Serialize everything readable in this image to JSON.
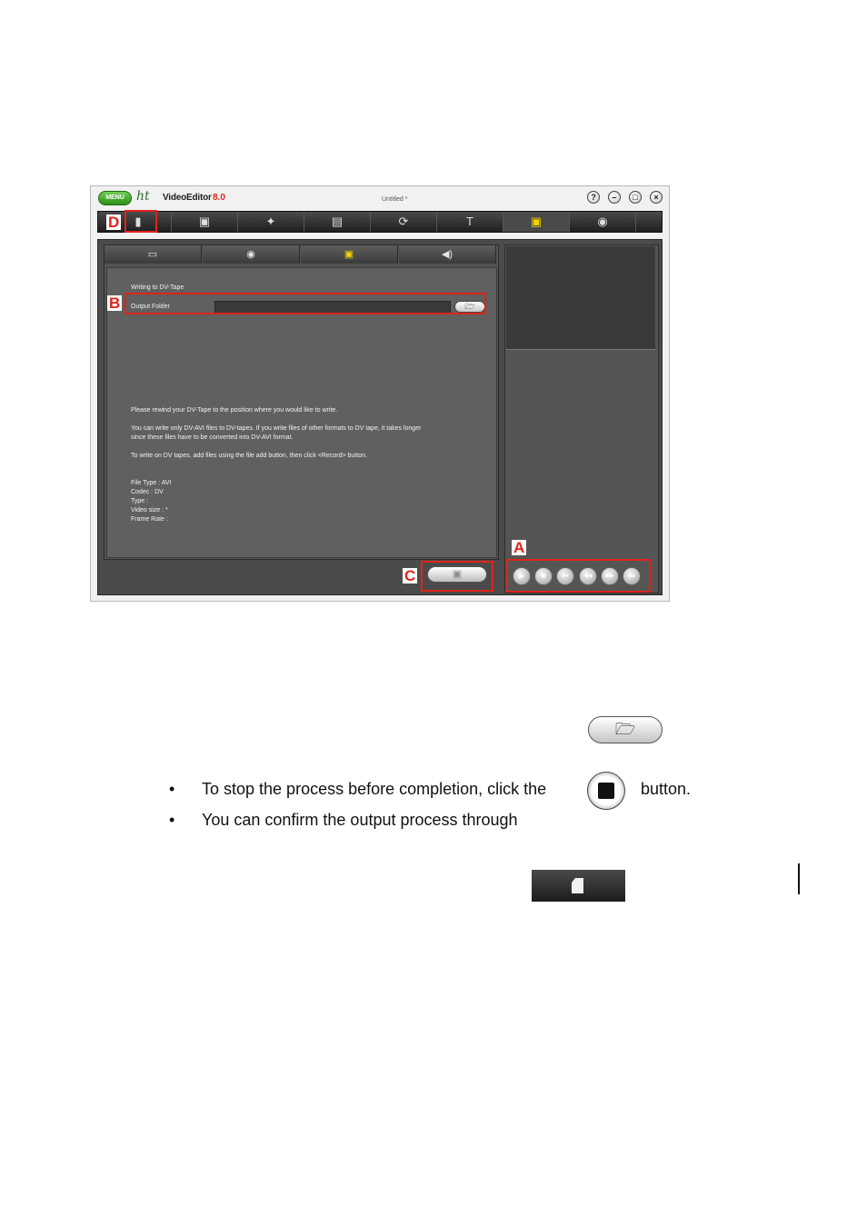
{
  "app": {
    "menu_label": "MENU",
    "logo_ht": "ht",
    "logo_name": "VideoEditor",
    "logo_version": "8.0",
    "doc_title": "Untitled *",
    "window_buttons": [
      {
        "icon": "help-icon",
        "glyph": "?"
      },
      {
        "icon": "minimize-icon",
        "glyph": "–"
      },
      {
        "icon": "maximize-icon",
        "glyph": "□"
      },
      {
        "icon": "close-icon",
        "glyph": "×"
      }
    ],
    "toolbar": [
      {
        "icon": "new-project-icon",
        "glyph": "▮"
      },
      {
        "icon": "capture-icon",
        "glyph": "▣"
      },
      {
        "icon": "effects-wand-icon",
        "glyph": "✦"
      },
      {
        "icon": "timeline-icon",
        "glyph": "▤"
      },
      {
        "icon": "transition-icon",
        "glyph": "⟳"
      },
      {
        "icon": "text-icon",
        "glyph": "T"
      },
      {
        "icon": "save-output-icon",
        "glyph": "▣",
        "active": true
      },
      {
        "icon": "disc-burn-icon",
        "glyph": "◉"
      }
    ],
    "subtabs": [
      {
        "icon": "film-strip-icon",
        "glyph": "▭"
      },
      {
        "icon": "disc-output-icon",
        "glyph": "◉"
      },
      {
        "icon": "dv-tape-icon",
        "glyph": "▣",
        "active": true
      },
      {
        "icon": "audio-icon",
        "glyph": "◀)"
      }
    ],
    "panel": {
      "heading": "Writing to DV-Tape",
      "output_folder_label": "Output Folder",
      "output_folder_value": "",
      "info_1": "Please rewind your DV-Tape to the position where you would like to write.",
      "info_2a": "You can write only DV-AVI files to DV-tapes.  If you write files of other formats to DV tape, it takes longer",
      "info_2b": "since these files have to be converted into DV-AVI format.",
      "info_3": "To write on DV tapes, add files using the file add button, then click <Record> button.",
      "spec_file_type": "File Type : AVI",
      "spec_codec": "Codec : DV",
      "spec_type": "Type :",
      "spec_video_size": "Video size : *",
      "spec_frame_rate": "Frame Rate :"
    },
    "playback_controls": [
      {
        "icon": "play-icon",
        "glyph": "▶"
      },
      {
        "icon": "stop-icon",
        "glyph": "■"
      },
      {
        "icon": "skip-start-icon",
        "glyph": "⏮"
      },
      {
        "icon": "rewind-icon",
        "glyph": "◀◀"
      },
      {
        "icon": "fast-forward-icon",
        "glyph": "▶▶"
      },
      {
        "icon": "skip-end-icon",
        "glyph": "⏭"
      }
    ],
    "callouts": {
      "a": "A",
      "b": "B",
      "c": "C",
      "d": "D"
    },
    "accent_red": "#e0231a",
    "accent_yellow": "#f3d500"
  },
  "doc": {
    "bullets": [
      {
        "glyph": "•",
        "text": "To stop the process before completion, click the",
        "suffix": "button."
      },
      {
        "glyph": "•",
        "text": "You can confirm the output process through",
        "suffix": ""
      }
    ],
    "browse_icon": "folder-open-icon",
    "stop_icon": "stop-icon",
    "new_icon": "new-project-icon"
  }
}
